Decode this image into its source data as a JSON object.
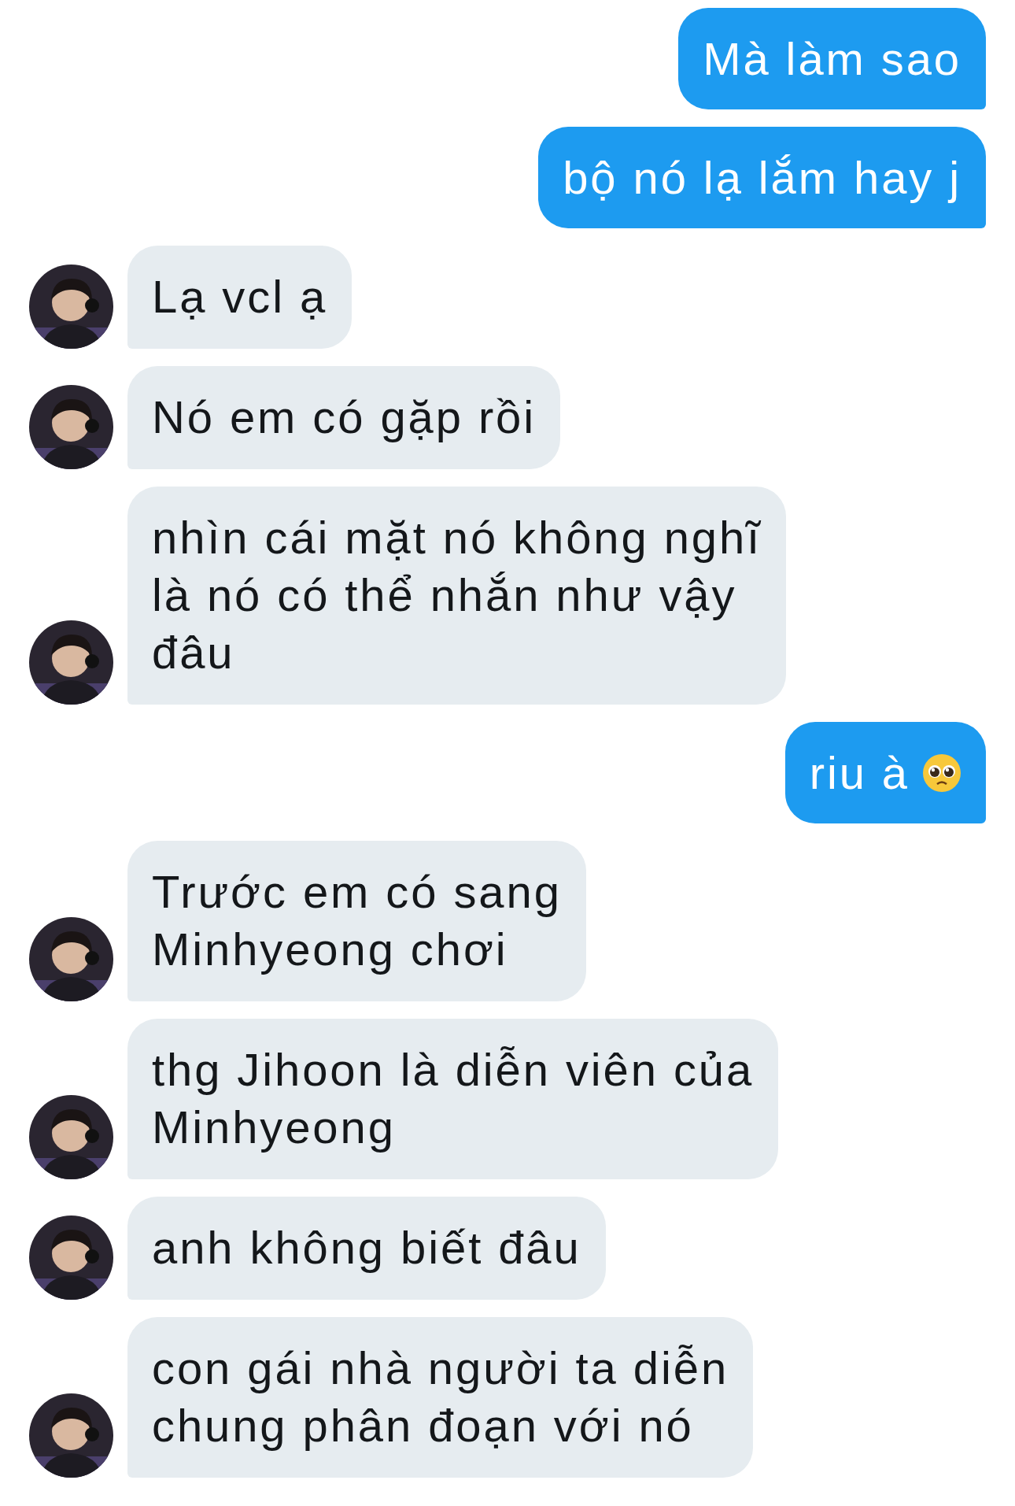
{
  "messages": [
    {
      "kind": "sent",
      "lines": [
        "Mà làm sao"
      ]
    },
    {
      "kind": "sent",
      "lines": [
        "bộ nó lạ lắm hay j"
      ]
    },
    {
      "kind": "received",
      "lines": [
        "Lạ vcl ạ"
      ]
    },
    {
      "kind": "received",
      "lines": [
        "Nó em có gặp rồi"
      ]
    },
    {
      "kind": "received",
      "lines": [
        "nhìn cái mặt nó không nghĩ",
        "là nó có thể nhắn như vậy",
        "đâu"
      ]
    },
    {
      "kind": "sent",
      "lines": [
        "riu à"
      ],
      "with_emoji": true
    },
    {
      "kind": "received",
      "lines": [
        "Trước em có sang",
        "Minhyeong chơi"
      ]
    },
    {
      "kind": "received",
      "lines": [
        "thg Jihoon là diễn viên của",
        "Minhyeong"
      ]
    },
    {
      "kind": "received",
      "lines": [
        "anh không biết đâu"
      ]
    },
    {
      "kind": "received",
      "lines": [
        "con gái nhà người ta diễn",
        "chung phân đoạn với nó"
      ]
    }
  ]
}
